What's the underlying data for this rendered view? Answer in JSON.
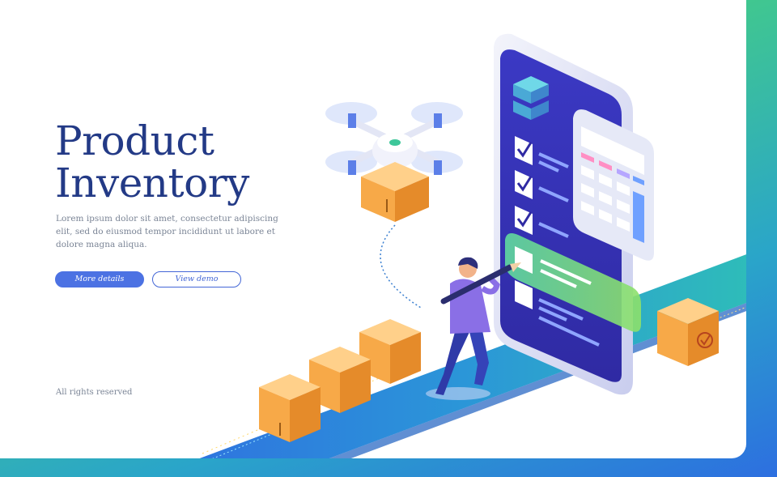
{
  "hero": {
    "title_line1": "Product",
    "title_line2": "Inventory",
    "description": "Lorem ipsum dolor sit amet, consectetur adipiscing elit, sed do eiusmod tempor incididunt ut labore et dolore magna aliqua.",
    "primary_button": "More details",
    "secondary_button": "View demo"
  },
  "footer": {
    "text": "All rights reserved"
  },
  "colors": {
    "title": "#233a86",
    "primary": "#4c72e3",
    "phone_screen": "#3a33b8",
    "box": "#f7a948",
    "belt": "#2b8fd6"
  },
  "icons": [
    "drone-icon",
    "cardboard-box-icon",
    "checkbox-icon",
    "calculator-icon",
    "smartphone-icon",
    "pencil-icon"
  ]
}
